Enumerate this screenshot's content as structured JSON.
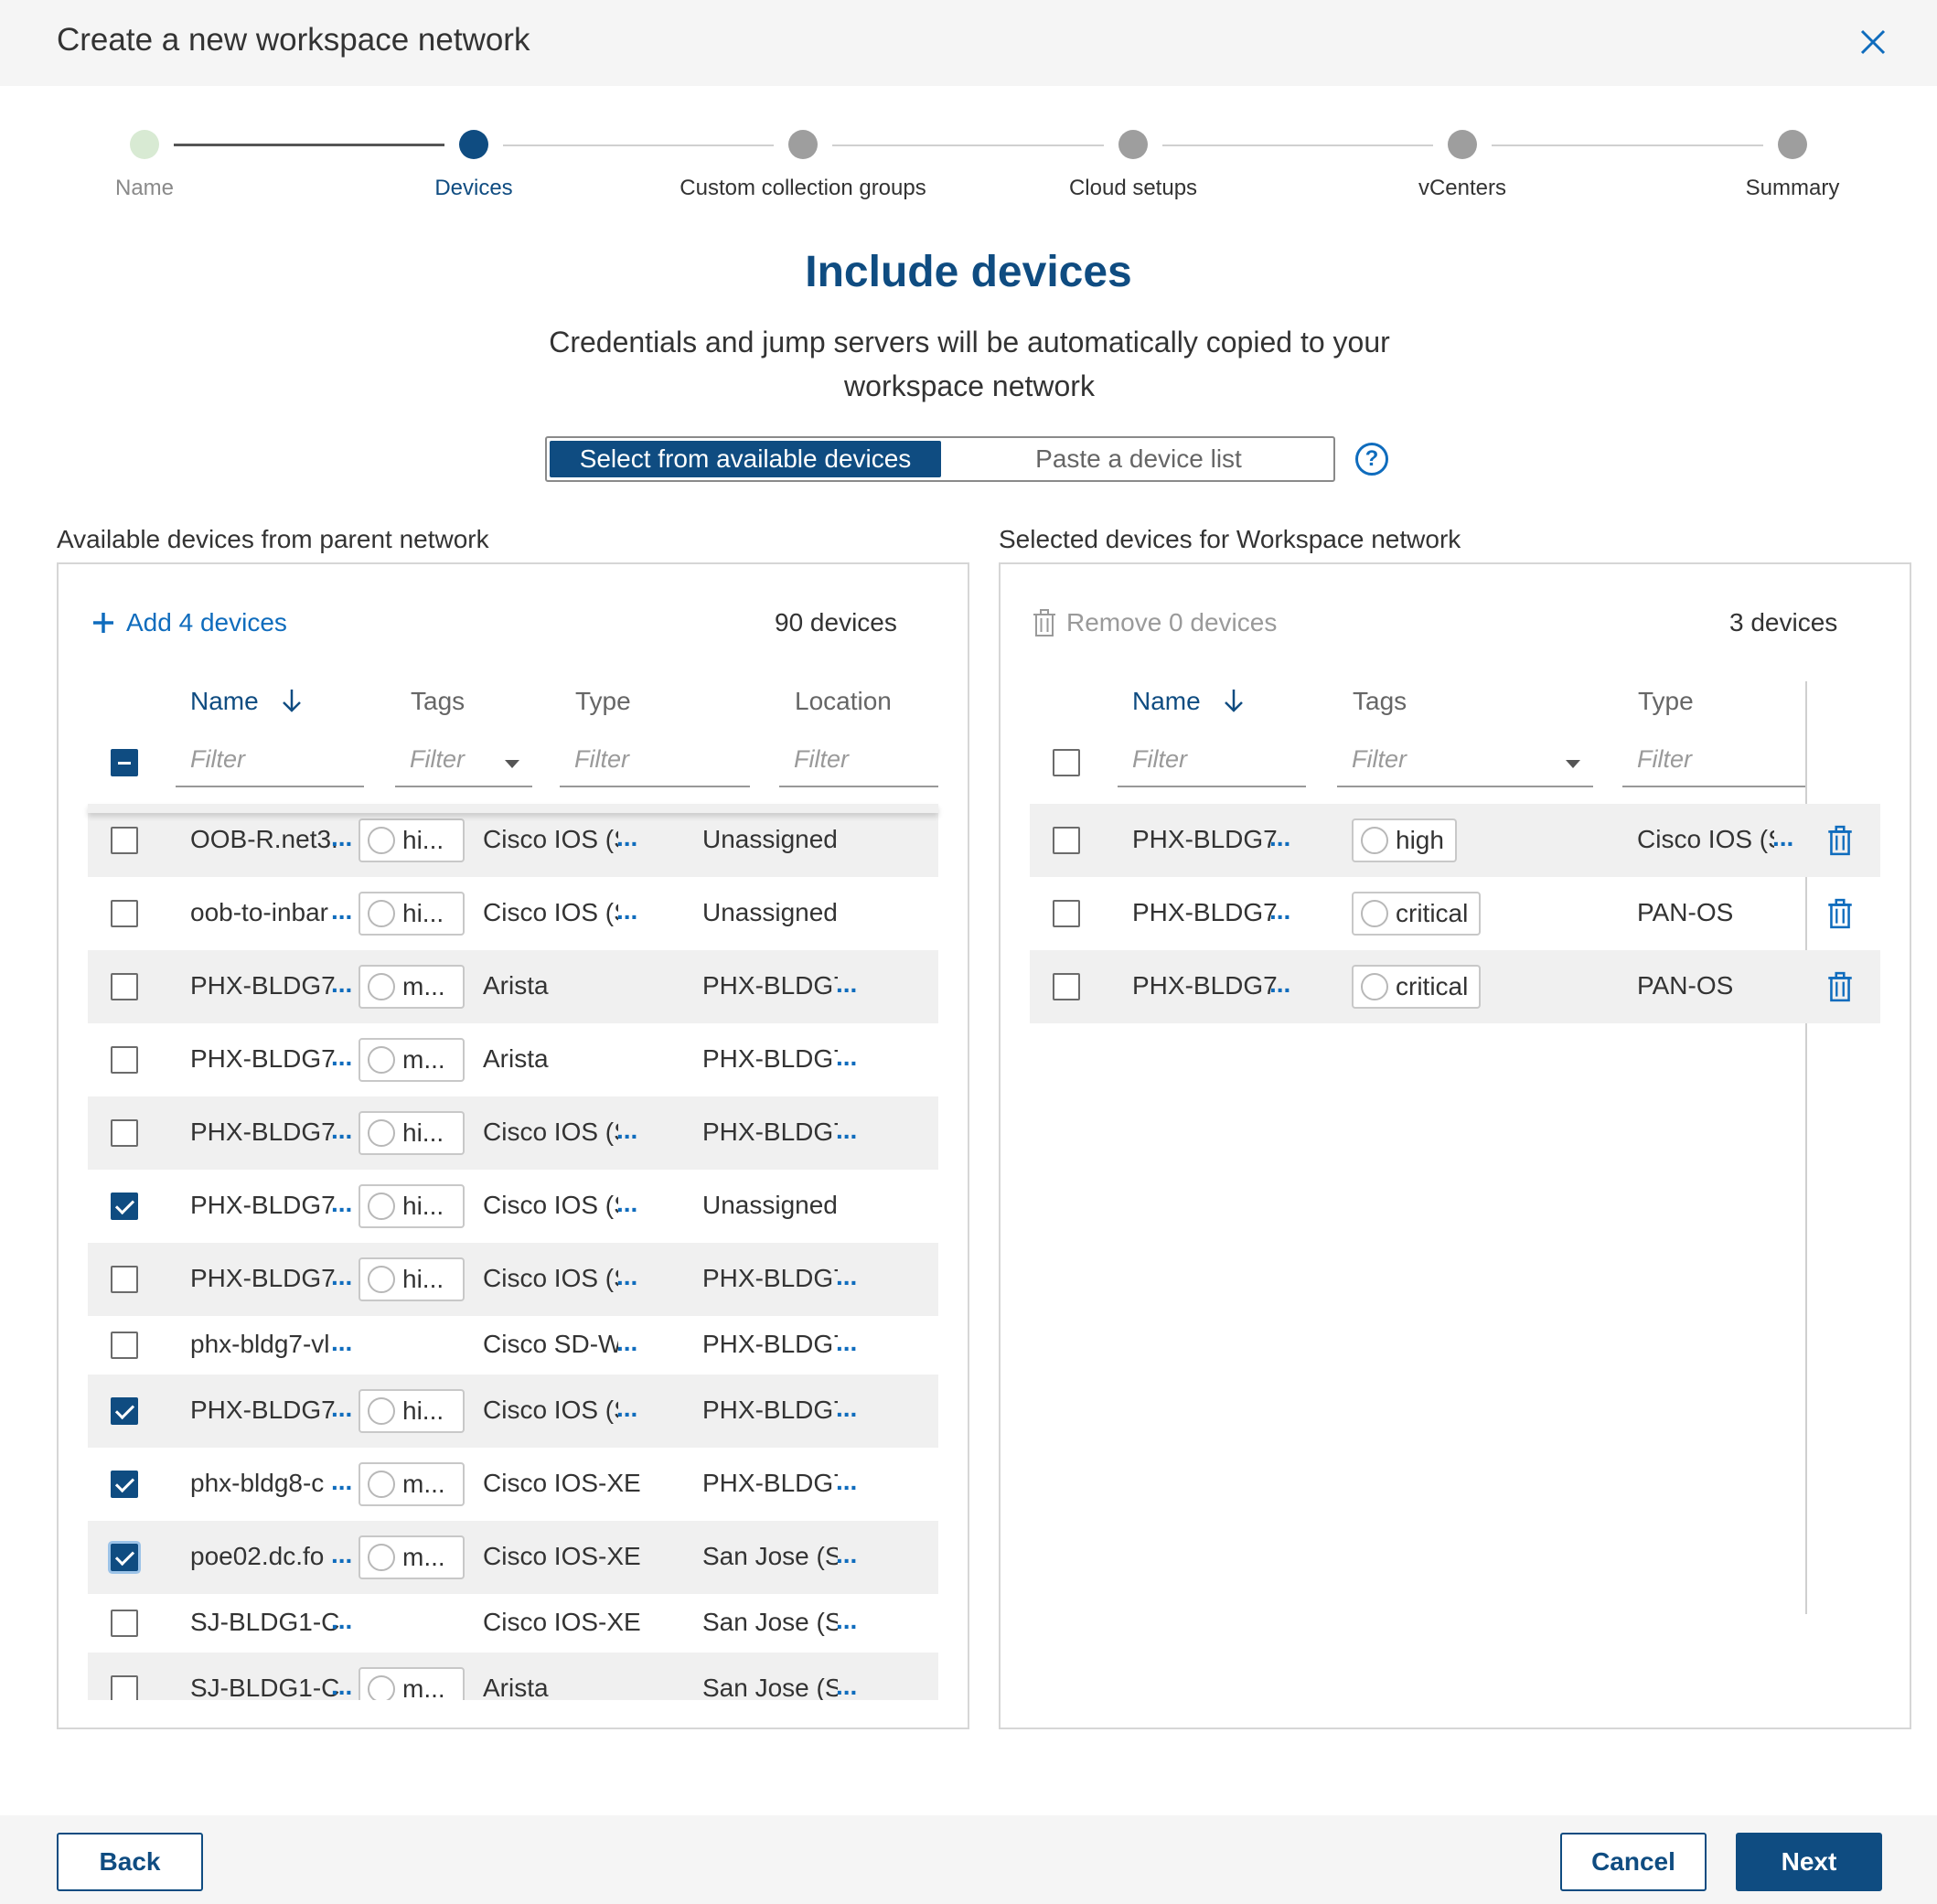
{
  "dialog": {
    "title": "Create a new workspace network"
  },
  "stepper": {
    "steps": [
      {
        "label": "Name",
        "state": "done"
      },
      {
        "label": "Devices",
        "state": "active"
      },
      {
        "label": "Custom collection groups",
        "state": "pending"
      },
      {
        "label": "Cloud setups",
        "state": "pending"
      },
      {
        "label": "vCenters",
        "state": "pending"
      },
      {
        "label": "Summary",
        "state": "pending"
      }
    ]
  },
  "page": {
    "heading": "Include devices",
    "subheading": "Credentials and jump servers will be automatically copied to your workspace network"
  },
  "mode_toggle": {
    "options": [
      "Select from available devices",
      "Paste a device list"
    ],
    "selected": "Select from available devices"
  },
  "left_panel": {
    "label": "Available devices from parent network",
    "action_label": "Add 4 devices",
    "count_label": "90 devices",
    "columns": [
      "Name",
      "Tags",
      "Type",
      "Location"
    ],
    "filter_placeholder": "Filter",
    "rows": [
      {
        "name": "OOB-R.net3.",
        "tag": "hi...",
        "type": "Cisco IOS (S",
        "location": "Unassigned",
        "checked": false,
        "type_more": true,
        "loc_more": false
      },
      {
        "name": "oob-to-inbar",
        "tag": "hi...",
        "type": "Cisco IOS (S",
        "location": "Unassigned",
        "checked": false,
        "type_more": true,
        "loc_more": false
      },
      {
        "name": "PHX-BLDG7",
        "tag": "m...",
        "type": "Arista",
        "location": "PHX-BLDG7",
        "checked": false,
        "type_more": false,
        "loc_more": true
      },
      {
        "name": "PHX-BLDG7",
        "tag": "m...",
        "type": "Arista",
        "location": "PHX-BLDG7",
        "checked": false,
        "type_more": false,
        "loc_more": true
      },
      {
        "name": "PHX-BLDG7",
        "tag": "hi...",
        "type": "Cisco IOS (S",
        "location": "PHX-BLDG7",
        "checked": false,
        "type_more": true,
        "loc_more": true
      },
      {
        "name": "PHX-BLDG7",
        "tag": "hi...",
        "type": "Cisco IOS (S",
        "location": "Unassigned",
        "checked": true,
        "type_more": true,
        "loc_more": false
      },
      {
        "name": "PHX-BLDG7",
        "tag": "hi...",
        "type": "Cisco IOS (S",
        "location": "PHX-BLDG7",
        "checked": false,
        "type_more": true,
        "loc_more": true
      },
      {
        "name": "phx-bldg7-vl",
        "tag": "",
        "type": "Cisco SD-W.",
        "location": "PHX-BLDG7",
        "checked": false,
        "type_more": true,
        "loc_more": true
      },
      {
        "name": "PHX-BLDG7",
        "tag": "hi...",
        "type": "Cisco IOS (S",
        "location": "PHX-BLDG7",
        "checked": true,
        "type_more": true,
        "loc_more": true
      },
      {
        "name": "phx-bldg8-c",
        "tag": "m...",
        "type": "Cisco IOS-XE",
        "location": "PHX-BLDG7",
        "checked": true,
        "type_more": false,
        "loc_more": true
      },
      {
        "name": "poe02.dc.fo",
        "tag": "m...",
        "type": "Cisco IOS-XE",
        "location": "San Jose (S",
        "checked": true,
        "type_more": false,
        "loc_more": true
      },
      {
        "name": "SJ-BLDG1-C",
        "tag": "",
        "type": "Cisco IOS-XE",
        "location": "San Jose (S",
        "checked": false,
        "type_more": false,
        "loc_more": true
      },
      {
        "name": "SJ-BLDG1-C",
        "tag": "m...",
        "type": "Arista",
        "location": "San Jose (S",
        "checked": false,
        "type_more": false,
        "loc_more": true
      }
    ]
  },
  "right_panel": {
    "label": "Selected devices for Workspace network",
    "action_label": "Remove 0 devices",
    "count_label": "3 devices",
    "columns": [
      "Name",
      "Tags",
      "Type"
    ],
    "filter_placeholder": "Filter",
    "rows": [
      {
        "name": "PHX-BLDG7",
        "tag": "high",
        "type": "Cisco IOS (S",
        "type_more": true
      },
      {
        "name": "PHX-BLDG7",
        "tag": "critical",
        "type": "PAN-OS",
        "type_more": false
      },
      {
        "name": "PHX-BLDG7",
        "tag": "critical",
        "type": "PAN-OS",
        "type_more": false
      }
    ]
  },
  "footer": {
    "back_label": "Back",
    "cancel_label": "Cancel",
    "next_label": "Next"
  },
  "colors": {
    "primary": "#0f4c81",
    "link": "#0f6cbd",
    "step_done": "#d8ead3",
    "step_pending": "#9e9e9e"
  },
  "more_glyph": "..."
}
